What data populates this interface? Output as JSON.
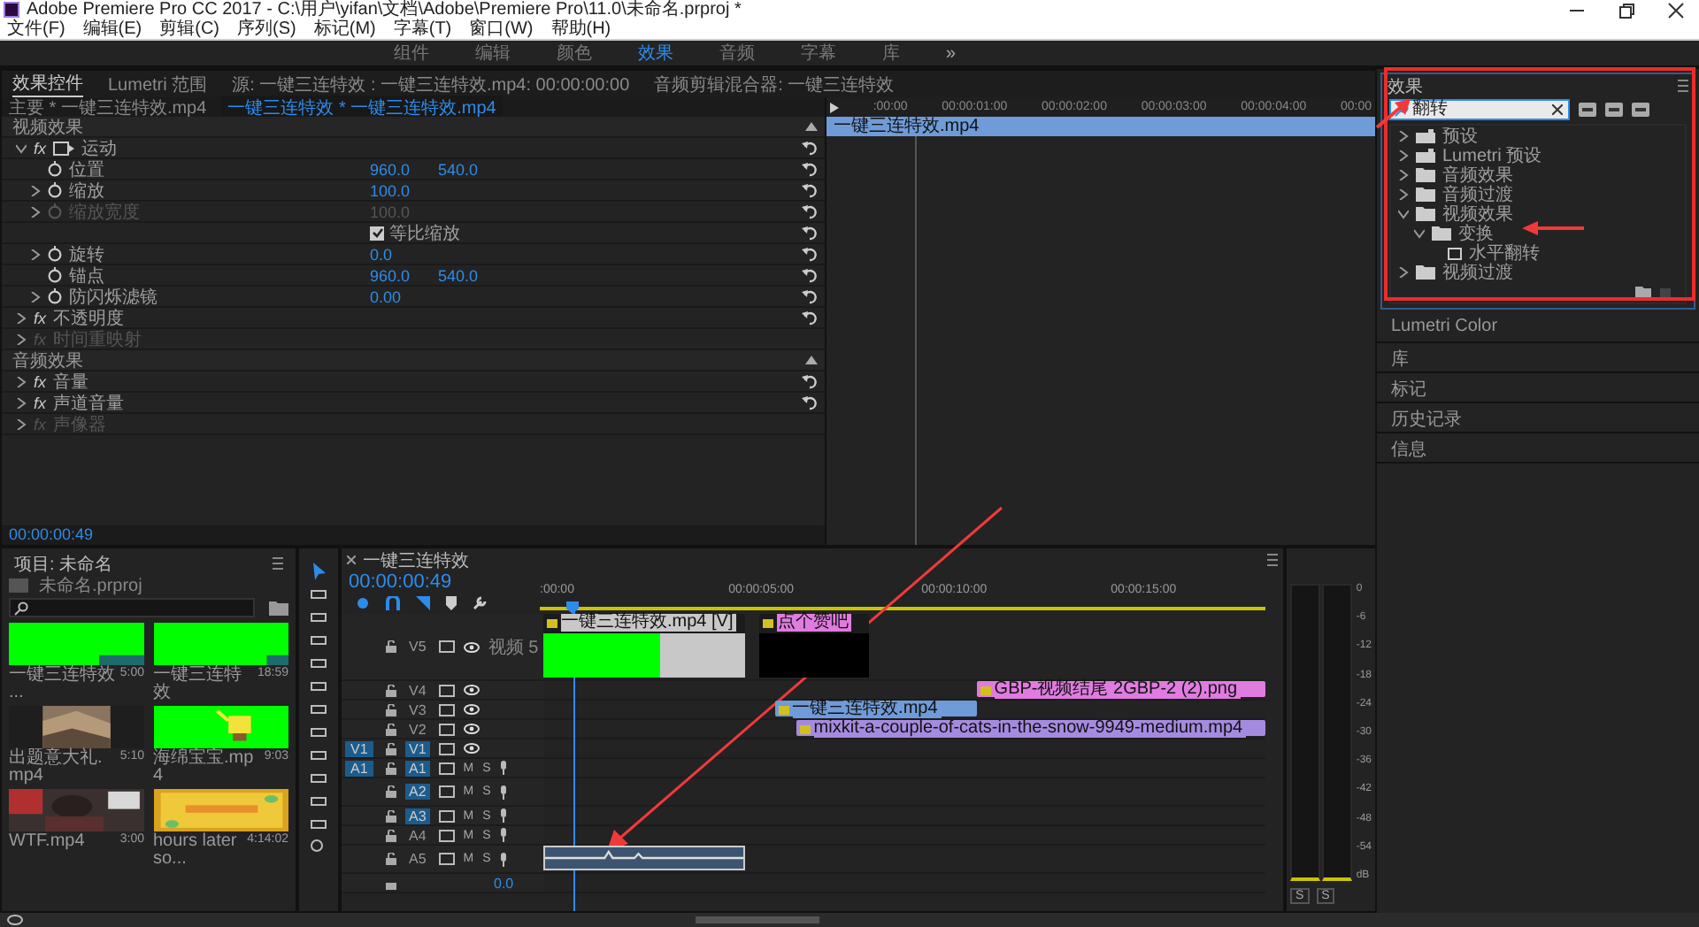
{
  "window": {
    "title": "Adobe Premiere Pro CC 2017 - C:\\用户\\yifan\\文档\\Adobe\\Premiere Pro\\11.0\\未命名.prproj *"
  },
  "menu": [
    "文件(F)",
    "编辑(E)",
    "剪辑(C)",
    "序列(S)",
    "标记(M)",
    "字幕(T)",
    "窗口(W)",
    "帮助(H)"
  ],
  "workspaces": [
    {
      "label": "组件",
      "selected": false
    },
    {
      "label": "编辑",
      "selected": false
    },
    {
      "label": "颜色",
      "selected": false
    },
    {
      "label": "效果",
      "selected": true
    },
    {
      "label": "音频",
      "selected": false
    },
    {
      "label": "字幕",
      "selected": false
    },
    {
      "label": "库",
      "selected": false
    }
  ],
  "workspace_more": "»",
  "effect_controls": {
    "tabs": [
      {
        "label": "效果控件",
        "selected": true
      },
      {
        "label": "Lumetri 范围",
        "selected": false
      },
      {
        "label": "源: 一键三连特效 : 一键三连特效.mp4: 00:00:00:00",
        "selected": false
      },
      {
        "label": "音频剪辑混合器: 一键三连特效",
        "selected": false
      }
    ],
    "master": "主要 * 一键三连特效.mp4",
    "sequence": "一键三连特效 * 一键三连特效.mp4",
    "rows": [
      {
        "kind": "section",
        "label": "视频效果"
      },
      {
        "kind": "effect",
        "badge": "fx",
        "label": "运动",
        "expanded": true,
        "disabled": false,
        "reset": true
      },
      {
        "kind": "param",
        "label": "位置",
        "values": [
          "960.0",
          "540.0"
        ],
        "expandable": false,
        "disabled": false
      },
      {
        "kind": "param",
        "label": "缩放",
        "values": [
          "100.0"
        ],
        "expandable": true,
        "disabled": false
      },
      {
        "kind": "param",
        "label": "缩放宽度",
        "values": [
          "100.0"
        ],
        "expandable": true,
        "disabled": true
      },
      {
        "kind": "checkbox",
        "label": "等比缩放",
        "checked": true
      },
      {
        "kind": "param",
        "label": "旋转",
        "values": [
          "0.0"
        ],
        "expandable": true,
        "disabled": false
      },
      {
        "kind": "param",
        "label": "锚点",
        "values": [
          "960.0",
          "540.0"
        ],
        "expandable": false,
        "disabled": false
      },
      {
        "kind": "param",
        "label": "防闪烁滤镜",
        "values": [
          "0.00"
        ],
        "expandable": true,
        "disabled": false
      },
      {
        "kind": "effect",
        "badge": "fx",
        "label": "不透明度",
        "expanded": false,
        "disabled": false,
        "reset": true
      },
      {
        "kind": "effect",
        "badge": "fx",
        "label": "时间重映射",
        "expanded": false,
        "disabled": true,
        "reset": false
      },
      {
        "kind": "section",
        "label": "音频效果"
      },
      {
        "kind": "effect",
        "badge": "fx",
        "label": "音量",
        "expanded": false,
        "disabled": false,
        "reset": true
      },
      {
        "kind": "effect",
        "badge": "fx",
        "label": "声道音量",
        "expanded": false,
        "disabled": false,
        "reset": true
      },
      {
        "kind": "effect",
        "badge": "fx",
        "label": "声像器",
        "expanded": false,
        "disabled": true,
        "reset": false
      }
    ],
    "timecode": "00:00:00:49",
    "ticks": [
      ":00:00",
      "00:00:01:00",
      "00:00:02:00",
      "00:00:03:00",
      "00:00:04:00",
      "00:00"
    ],
    "clip": "一键三连特效.mp4"
  },
  "effects_panel": {
    "title": "效果",
    "search": "翻转",
    "tree": [
      {
        "kind": "preset",
        "label": "预设",
        "expanded": false
      },
      {
        "kind": "preset",
        "label": "Lumetri 预设",
        "expanded": false
      },
      {
        "kind": "folder",
        "label": "音频效果",
        "expanded": false
      },
      {
        "kind": "folder",
        "label": "音频过渡",
        "expanded": false
      },
      {
        "kind": "folder",
        "label": "视频效果",
        "expanded": true,
        "children": [
          {
            "kind": "folder",
            "label": "变换",
            "expanded": true,
            "children": [
              {
                "kind": "effect",
                "label": "水平翻转"
              }
            ]
          }
        ]
      },
      {
        "kind": "folder",
        "label": "视频过渡",
        "expanded": false
      }
    ]
  },
  "side_panels": [
    "Lumetri Color",
    "库",
    "标记",
    "历史记录",
    "信息"
  ],
  "project": {
    "title": "项目: 未命名",
    "file": "未命名.prproj",
    "items": [
      {
        "name": "一键三连特效 ...",
        "duration": "5:00"
      },
      {
        "name": "一键三连特效",
        "duration": "18:59"
      },
      {
        "name": "出题意大礼.mp4",
        "duration": "5:10"
      },
      {
        "name": "海绵宝宝.mp4",
        "duration": "9:03"
      },
      {
        "name": "WTF.mp4",
        "duration": "3:00"
      },
      {
        "name": "hours later so...",
        "duration": "4:14:02"
      }
    ]
  },
  "timeline": {
    "title": "一键三连特效",
    "timecode": "00:00:00:49",
    "ticks": [
      ":00:00",
      "00:00:05:00",
      "00:00:10:00",
      "00:00:15:00"
    ],
    "tracks": [
      {
        "kind": "video",
        "name": "V5",
        "label": "视频 5",
        "tall": true,
        "targeted": false,
        "clips": [
          {
            "label": "一键三连特效.mp4 [V]",
            "color": "#c8c8c8"
          },
          {
            "label": "点个赞吧",
            "color": "#e07be0"
          }
        ]
      },
      {
        "kind": "video",
        "name": "V4",
        "tall": false,
        "targeted": false,
        "clips": [
          {
            "label": "GBP-视频结尾 2GBP-2 (2).png",
            "color": "#e07be0"
          }
        ]
      },
      {
        "kind": "video",
        "name": "V3",
        "tall": false,
        "targeted": false,
        "clips": [
          {
            "label": "一键三连特效.mp4",
            "color": "#6f9bd8"
          }
        ]
      },
      {
        "kind": "video",
        "name": "V2",
        "tall": false,
        "targeted": false,
        "clips": [
          {
            "label": "mixkit-a-couple-of-cats-in-the-snow-9949-medium.mp4",
            "color": "#a58be0"
          }
        ]
      },
      {
        "kind": "video",
        "name": "V1",
        "tall": false,
        "source": "V1",
        "targeted": true
      },
      {
        "kind": "audio",
        "name": "A1",
        "tall": false,
        "source": "A1",
        "targeted": true,
        "mute": "M",
        "solo": "S"
      },
      {
        "kind": "audio",
        "name": "A2",
        "tall": true,
        "targeted": true,
        "mute": "M",
        "solo": "S"
      },
      {
        "kind": "audio",
        "name": "A3",
        "tall": false,
        "targeted": true,
        "mute": "M",
        "solo": "S"
      },
      {
        "kind": "audio",
        "name": "A4",
        "tall": false,
        "targeted": false,
        "mute": "M",
        "solo": "S"
      },
      {
        "kind": "audio",
        "name": "A5",
        "tall": true,
        "targeted": false,
        "mute": "M",
        "solo": "S",
        "clips": [
          {
            "color": "#3d5470"
          }
        ]
      }
    ],
    "master": "0.0"
  },
  "meter": {
    "scale": [
      "0",
      "-6",
      "-12",
      "-18",
      "-24",
      "-30",
      "-36",
      "-42",
      "-48",
      "-54",
      "dB"
    ],
    "solo": [
      "S",
      "S"
    ]
  }
}
